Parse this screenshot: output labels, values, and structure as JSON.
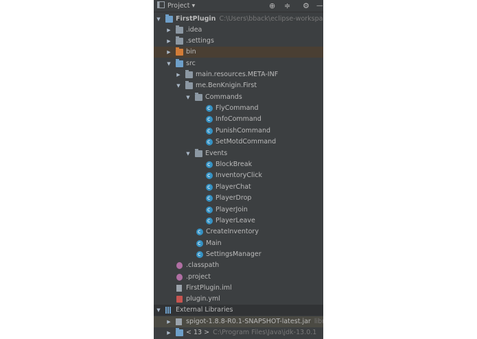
{
  "toolbar": {
    "view_label": "Project",
    "dropdown_glyph": "▾",
    "target_glyph": "⊕",
    "collapse_glyph": "≑",
    "settings_glyph": "⚙",
    "hide_glyph": "—"
  },
  "tree": [
    {
      "label": "FirstPlugin",
      "extra": "C:\\Users\\bback\\eclipse-workspace\\Fi"
    },
    {
      "label": ".idea"
    },
    {
      "label": ".settings"
    },
    {
      "label": "bin"
    },
    {
      "label": "src"
    },
    {
      "label": "main.resources.META-INF"
    },
    {
      "label": "me.BenKnigin.First"
    },
    {
      "label": "Commands"
    },
    {
      "label": "FlyCommand"
    },
    {
      "label": "InfoCommand"
    },
    {
      "label": "PunishCommand"
    },
    {
      "label": "SetMotdCommand"
    },
    {
      "label": "Events"
    },
    {
      "label": "BlockBreak"
    },
    {
      "label": "InventoryClick"
    },
    {
      "label": "PlayerChat"
    },
    {
      "label": "PlayerDrop"
    },
    {
      "label": "PlayerJoin"
    },
    {
      "label": "PlayerLeave"
    },
    {
      "label": "CreateInventory"
    },
    {
      "label": "Main"
    },
    {
      "label": "SettingsManager"
    },
    {
      "label": ".classpath"
    },
    {
      "label": ".project"
    },
    {
      "label": "FirstPlugin.iml"
    },
    {
      "label": "plugin.yml"
    },
    {
      "label": "External Libraries"
    },
    {
      "label": "spigot-1.8.8-R0.1-SNAPSHOT-latest.jar",
      "extra": "library"
    },
    {
      "label": "< 13 >",
      "extra": "C:\\Program Files\\Java\\jdk-13.0.1"
    }
  ],
  "arrows": {
    "expanded": "▼",
    "collapsed": "▶"
  }
}
